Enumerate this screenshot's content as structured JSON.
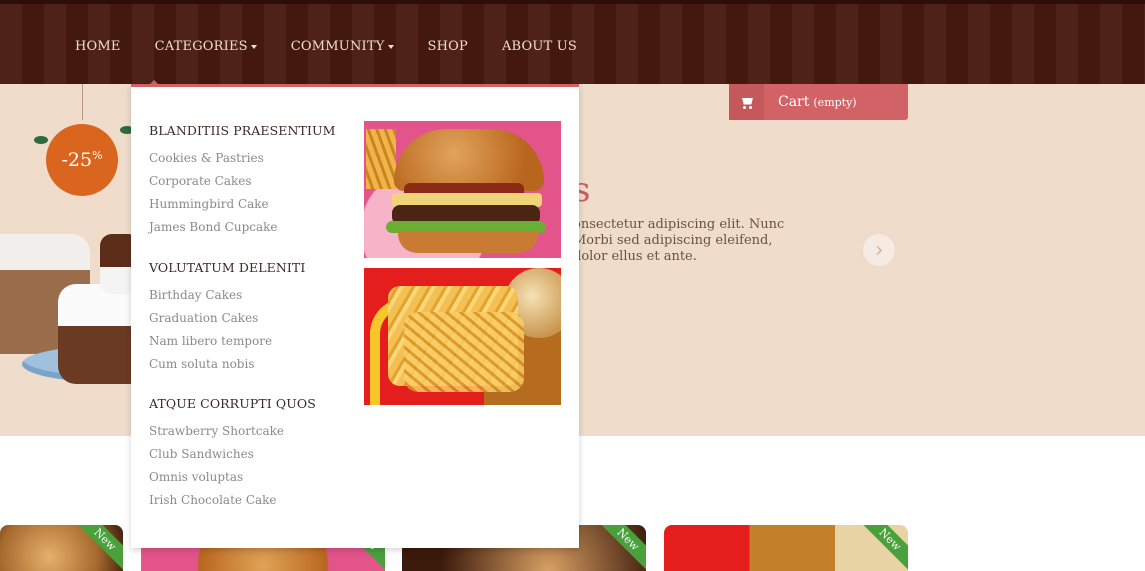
{
  "nav": {
    "items": [
      {
        "label": "HOME",
        "caret": false
      },
      {
        "label": "CATEGORIES",
        "caret": true
      },
      {
        "label": "COMMUNITY",
        "caret": true
      },
      {
        "label": "SHOP",
        "caret": false
      },
      {
        "label": "ABOUT US",
        "caret": false
      }
    ]
  },
  "cart": {
    "label": "Cart",
    "status": "(empty)",
    "icon": "shopping-cart-icon"
  },
  "hero": {
    "badge_value": "-25",
    "badge_unit": "%",
    "title_fragment": "s",
    "text": "onsectetur adipiscing elit. Nunc Morbi sed adipiscing eleifend, dolor ellus et ante.",
    "next_icon": "chevron-right-icon"
  },
  "dropdown": {
    "groups": [
      {
        "title": "BLANDITIIS PRAESENTIUM",
        "links": [
          "Cookies & Pastries",
          "Corporate Cakes",
          "Hummingbird Cake",
          "James Bond Cupcake"
        ]
      },
      {
        "title": "VOLUTATUM DELENITI",
        "links": [
          "Birthday Cakes",
          "Graduation Cakes",
          "Nam libero tempore",
          "Cum soluta nobis"
        ]
      },
      {
        "title": "ATQUE CORRUPTI QUOS",
        "links": [
          "Strawberry Shortcake",
          "Club Sandwiches",
          "Omnis voluptas",
          "Irish Chocolate Cake"
        ]
      }
    ]
  },
  "products": {
    "ribbon_label": "New"
  },
  "colors": {
    "nav_bg": "#4e2218",
    "accent": "#d16265",
    "hero_bg": "#efdccb",
    "badge": "#d9651f",
    "ribbon": "#4aa03b"
  }
}
